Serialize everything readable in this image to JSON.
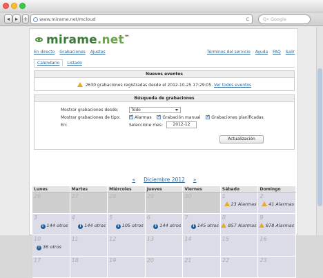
{
  "browser": {
    "url": "www.mirame.net/mcloud",
    "search_placeholder": "Q• Google",
    "back": "◂",
    "forward": "▸",
    "plus": "+",
    "reload": "C"
  },
  "site": {
    "logo_text": "mirame",
    "logo_tld": ".net",
    "logo_tm": "™"
  },
  "nav": {
    "left": [
      "En directo",
      "Grabaciones",
      "Ajustes"
    ],
    "right": [
      "Términos del servicio",
      "Ayuda",
      "FAQ",
      "Salir"
    ]
  },
  "subtabs": [
    "Calendario",
    "Listado"
  ],
  "events_box": {
    "title": "Nuevos eventos",
    "message": "2630 grabaciones registradas desde el 2012-10-25 17:29:05.",
    "link": "Ver todos eventos"
  },
  "search_box": {
    "title": "Búsqueda de grabaciones",
    "show_from_label": "Mostrar grabaciones desde:",
    "show_from_value": "Todo",
    "show_type_label": "Mostrar grabaciones de tipo:",
    "types": [
      "Alarmas",
      "Grabación manual",
      "Grabaciones planificadas"
    ],
    "en_label": "En:",
    "month_label": "Seleccione mes:",
    "month_value": "2012-12",
    "update_button": "Actualización"
  },
  "calendar": {
    "prev": "«",
    "title": "Diciembre 2012",
    "next": "»",
    "days": [
      "Lunes",
      "Martes",
      "Miércoles",
      "Jueves",
      "Viernes",
      "Sábado",
      "Domingo"
    ],
    "rows": [
      [
        {
          "num": "26",
          "out": true,
          "ev": ""
        },
        {
          "num": "27",
          "out": true,
          "ev": ""
        },
        {
          "num": "28",
          "out": true,
          "ev": ""
        },
        {
          "num": "29",
          "out": true,
          "ev": ""
        },
        {
          "num": "30",
          "out": true,
          "ev": ""
        },
        {
          "num": "1",
          "out": false,
          "ev": "23 Alarmas",
          "kind": "warn"
        },
        {
          "num": "2",
          "out": false,
          "ev": "41 Alarmas",
          "kind": "warn"
        }
      ],
      [
        {
          "num": "3",
          "out": false,
          "ev": "144 otros",
          "kind": "info"
        },
        {
          "num": "4",
          "out": false,
          "ev": "144 otros",
          "kind": "info"
        },
        {
          "num": "5",
          "out": false,
          "ev": "105 otros",
          "kind": "info"
        },
        {
          "num": "6",
          "out": false,
          "ev": "144 otros",
          "kind": "info"
        },
        {
          "num": "7",
          "out": false,
          "ev": "145 otros",
          "kind": "info"
        },
        {
          "num": "8",
          "out": false,
          "ev": "857 Alarmas",
          "kind": "warn"
        },
        {
          "num": "9",
          "out": false,
          "ev": "878 Alarmas",
          "kind": "warn"
        }
      ],
      [
        {
          "num": "10",
          "out": false,
          "ev": "36 otros",
          "kind": "info"
        },
        {
          "num": "11",
          "out": false,
          "ev": ""
        },
        {
          "num": "12",
          "out": false,
          "ev": ""
        },
        {
          "num": "13",
          "out": false,
          "ev": ""
        },
        {
          "num": "14",
          "out": false,
          "ev": ""
        },
        {
          "num": "15",
          "out": false,
          "ev": ""
        },
        {
          "num": "16",
          "out": false,
          "ev": ""
        }
      ],
      [
        {
          "num": "17",
          "out": false,
          "ev": ""
        },
        {
          "num": "18",
          "out": false,
          "ev": ""
        },
        {
          "num": "19",
          "out": false,
          "ev": ""
        },
        {
          "num": "20",
          "out": false,
          "ev": ""
        },
        {
          "num": "21",
          "out": false,
          "ev": ""
        },
        {
          "num": "22",
          "out": false,
          "ev": ""
        },
        {
          "num": "23",
          "out": false,
          "ev": ""
        }
      ]
    ]
  },
  "colors": {
    "brand_green": "#3d7a3a",
    "link_blue": "#2a6496",
    "warning": "#e8a92c",
    "info": "#1f5f9e"
  }
}
